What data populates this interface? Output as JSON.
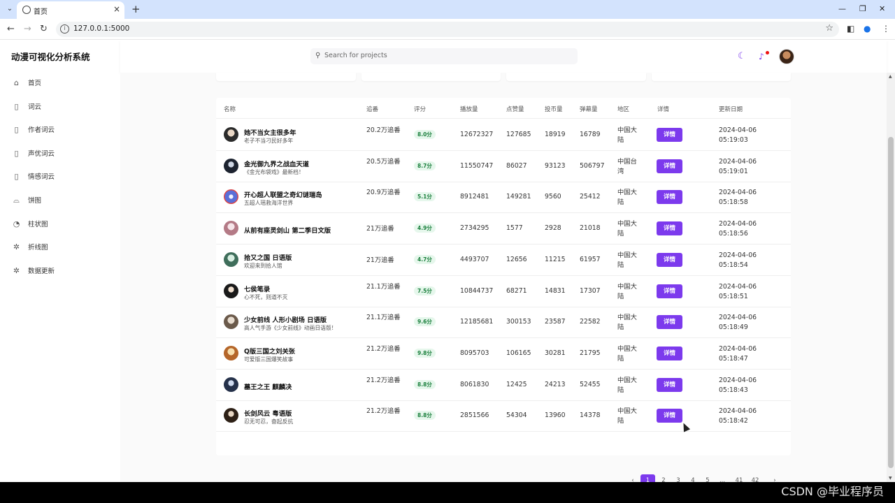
{
  "browser": {
    "tab_title": "首页",
    "url": "127.0.0.1:5000",
    "tab_close": "×",
    "new_tab": "+",
    "win_min": "—",
    "win_restore": "❐",
    "win_close": "✕"
  },
  "app": {
    "brand": "动漫可视化分析系统",
    "search_placeholder": "Search for projects"
  },
  "sidebar": {
    "items": [
      {
        "label": "首页",
        "icon": "home-icon"
      },
      {
        "label": "词云",
        "icon": "clipboard-icon"
      },
      {
        "label": "作者词云",
        "icon": "clipboard-icon"
      },
      {
        "label": "声优词云",
        "icon": "clipboard-icon"
      },
      {
        "label": "情感词云",
        "icon": "clipboard-icon"
      },
      {
        "label": "饼图",
        "icon": "pie-bag-icon"
      },
      {
        "label": "柱状图",
        "icon": "pie-chart-icon"
      },
      {
        "label": "折线图",
        "icon": "sparkle-icon"
      },
      {
        "label": "数据更新",
        "icon": "sparkle-icon"
      }
    ]
  },
  "table": {
    "headers": [
      "名称",
      "追番",
      "评分",
      "播放量",
      "点赞量",
      "投币量",
      "弹幕量",
      "地区",
      "详情",
      "更新日期"
    ],
    "detail_label": "详情",
    "rows": [
      {
        "title": "她不当女主很多年",
        "subtitle": "老子不当刁民好多年",
        "follow": "20.2万追番",
        "score": "8.0分",
        "plays": "12672327",
        "likes": "127685",
        "coins": "18919",
        "danmaku": "16789",
        "region": "中国大陆",
        "date": "2024-04-06\n05:19:03"
      },
      {
        "title": "金光御九界之战血天道",
        "subtitle": "《金光布袋戏》最新档！",
        "follow": "20.5万追番",
        "score": "8.7分",
        "plays": "11550747",
        "likes": "86027",
        "coins": "93123",
        "danmaku": "506797",
        "region": "中国台湾",
        "date": "2024-04-06\n05:19:01"
      },
      {
        "title": "开心超人联盟之奇幻谜瑞岛",
        "subtitle": "五超人瑶救海洋世界",
        "follow": "20.9万追番",
        "score": "5.1分",
        "plays": "8912481",
        "likes": "149281",
        "coins": "9560",
        "danmaku": "25412",
        "region": "中国大陆",
        "date": "2024-04-06\n05:18:58"
      },
      {
        "title": "从前有座灵剑山 第二季日文版",
        "subtitle": "",
        "follow": "21万追番",
        "score": "4.9分",
        "plays": "2734295",
        "likes": "1577",
        "coins": "2928",
        "danmaku": "21018",
        "region": "中国大陆",
        "date": "2024-04-06\n05:18:56"
      },
      {
        "title": "拾又之国 日语版",
        "subtitle": "欢迎来到拾人馆",
        "follow": "21万追番",
        "score": "4.7分",
        "plays": "4493707",
        "likes": "12656",
        "coins": "11215",
        "danmaku": "61957",
        "region": "中国大陆",
        "date": "2024-04-06\n05:18:54"
      },
      {
        "title": "七侯笔录",
        "subtitle": "心不死，则道不灭",
        "follow": "21.1万追番",
        "score": "7.5分",
        "plays": "10844737",
        "likes": "68271",
        "coins": "14831",
        "danmaku": "17307",
        "region": "中国大陆",
        "date": "2024-04-06\n05:18:51"
      },
      {
        "title": "少女前线 人形小剧场 日语版",
        "subtitle": "高人气手游《少女前线》动画日语版！",
        "follow": "21.1万追番",
        "score": "9.6分",
        "plays": "12185681",
        "likes": "300153",
        "coins": "23587",
        "danmaku": "22582",
        "region": "中国大陆",
        "date": "2024-04-06\n05:18:49"
      },
      {
        "title": "Q版三国之刘关张",
        "subtitle": "可爱版三国爆笑故事",
        "follow": "21.2万追番",
        "score": "9.8分",
        "plays": "8095703",
        "likes": "106165",
        "coins": "30281",
        "danmaku": "21795",
        "region": "中国大陆",
        "date": "2024-04-06\n05:18:47"
      },
      {
        "title": "墓王之王 麒麟决",
        "subtitle": "",
        "follow": "21.2万追番",
        "score": "8.8分",
        "plays": "8061830",
        "likes": "12425",
        "coins": "24213",
        "danmaku": "52455",
        "region": "中国大陆",
        "date": "2024-04-06\n05:18:43"
      },
      {
        "title": "长剑风云 粤语版",
        "subtitle": "忍无可忍，奋起反抗",
        "follow": "21.2万追番",
        "score": "8.8分",
        "plays": "2851566",
        "likes": "54304",
        "coins": "13960",
        "danmaku": "14378",
        "region": "中国大陆",
        "date": "2024-04-06\n05:18:42"
      }
    ]
  },
  "pagination": {
    "prev": "‹",
    "pages": [
      "1",
      "2",
      "3",
      "4",
      "5",
      "...",
      "41",
      "42"
    ],
    "current": "1",
    "next": "›"
  },
  "watermark": "CSDN @毕业程序员",
  "colors": {
    "accent": "#7c3aed",
    "score_bg": "#e6f7ec",
    "score_text": "#1a7f3c"
  }
}
